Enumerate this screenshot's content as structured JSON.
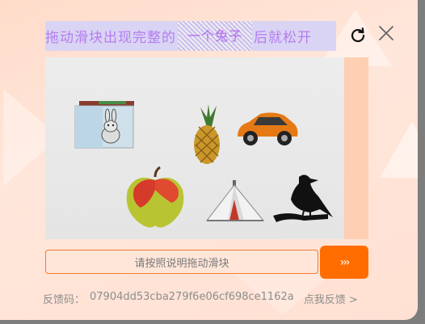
{
  "captcha": {
    "instruction_prefix": "拖动滑块出现完整的",
    "instruction_highlight": "一个兔子",
    "instruction_suffix": "后就松开",
    "slider_hint": "请按照说明拖动滑块",
    "slider_handle_label": "›››",
    "feedback_label": "反馈码：",
    "feedback_code": "07904dd53cba279f6e06cf698ce1162a",
    "feedback_link": "点我反馈 >"
  },
  "colors": {
    "accent": "#ff6d00",
    "instruction_text": "#b57cf0",
    "instruction_bg": "#d9d4f4"
  },
  "icons": {
    "refresh": "refresh-icon",
    "close": "close-icon"
  }
}
